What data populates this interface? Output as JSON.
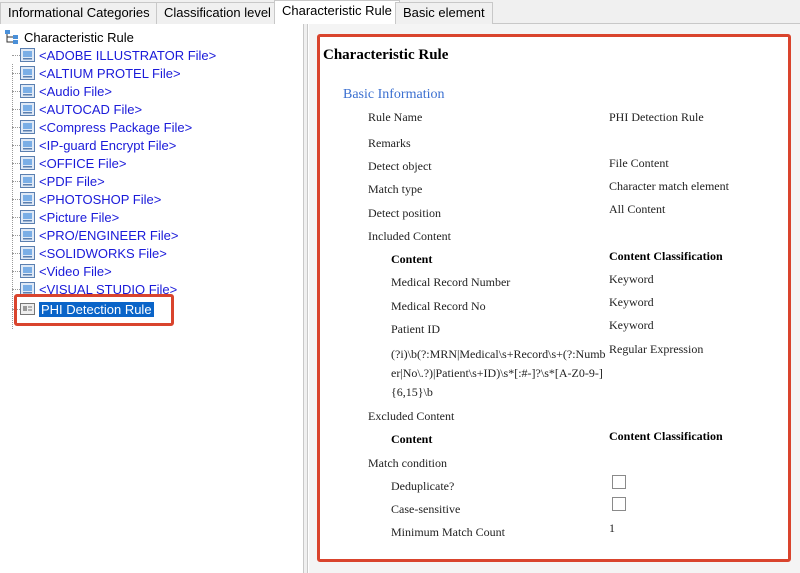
{
  "tabs": [
    {
      "label": "Informational Categories"
    },
    {
      "label": "Classification level"
    },
    {
      "label": "Characteristic Rule"
    },
    {
      "label": "Basic element"
    }
  ],
  "tree": {
    "root": "Characteristic Rule",
    "items": [
      {
        "label": "<ADOBE ILLUSTRATOR File>"
      },
      {
        "label": "<ALTIUM PROTEL File>"
      },
      {
        "label": "<Audio File>"
      },
      {
        "label": "<AUTOCAD File>"
      },
      {
        "label": "<Compress Package File>"
      },
      {
        "label": "<IP-guard Encrypt File>"
      },
      {
        "label": "<OFFICE File>"
      },
      {
        "label": "<PDF File>"
      },
      {
        "label": "<PHOTOSHOP File>"
      },
      {
        "label": "<Picture File>"
      },
      {
        "label": "<PRO/ENGINEER File>"
      },
      {
        "label": "<SOLIDWORKS File>"
      },
      {
        "label": "<Video File>"
      },
      {
        "label": "<VISUAL STUDIO File>"
      }
    ],
    "selected": "PHI Detection Rule"
  },
  "detail": {
    "title": "Characteristic Rule",
    "section": "Basic Information",
    "rule_name_label": "Rule Name",
    "rule_name_value": "PHI Detection Rule",
    "remarks_label": "Remarks",
    "detect_object_label": "Detect object",
    "detect_object_value": "File Content",
    "match_type_label": "Match type",
    "match_type_value": "Character match element",
    "detect_position_label": "Detect position",
    "detect_position_value": "All Content",
    "included_label": "Included Content",
    "content_header": "Content",
    "classification_header": "Content Classification",
    "included_rows": [
      {
        "content": "Medical Record Number",
        "classification": "Keyword"
      },
      {
        "content": "Medical Record No",
        "classification": "Keyword"
      },
      {
        "content": "Patient ID",
        "classification": "Keyword"
      },
      {
        "content": "(?i)\\b(?:MRN|Medical\\s+Record\\s+(?:Number|No\\.?)|Patient\\s+ID)\\s*[:#-]?\\s*[A-Z0-9-]{6,15}\\b",
        "classification": "Regular Expression"
      }
    ],
    "excluded_label": "Excluded Content",
    "match_condition_label": "Match condition",
    "deduplicate_label": "Deduplicate?",
    "case_sensitive_label": "Case-sensitive",
    "min_match_label": "Minimum Match Count",
    "min_match_value": "1"
  }
}
